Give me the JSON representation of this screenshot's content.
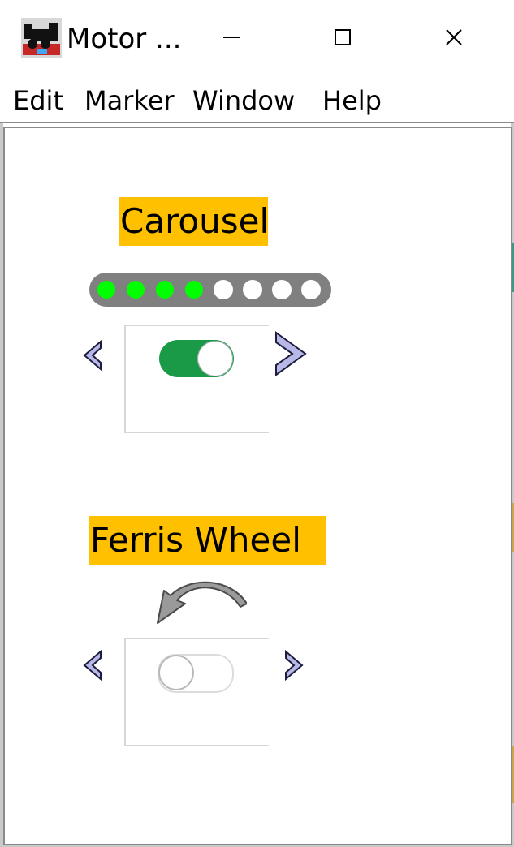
{
  "window": {
    "title": "Motor ...",
    "icon": "locomotive-app-icon",
    "controls": [
      "minimize-icon",
      "maximize-icon",
      "close-icon"
    ]
  },
  "menu": {
    "items": [
      "Edit",
      "Marker",
      "Window",
      "Help"
    ]
  },
  "panel": {
    "carousel": {
      "label": "Carousel",
      "label_bg": "#ffc000",
      "indicator_total": 8,
      "indicator_on": 4,
      "led_on_color": "#00ff00",
      "switch_state": "on",
      "switch_color": "#1a9a46"
    },
    "ferris_wheel": {
      "label": "Ferris Wheel",
      "label_bg": "#ffc000",
      "rotation_icon": "curved-arrow-icon",
      "switch_state": "off"
    }
  }
}
